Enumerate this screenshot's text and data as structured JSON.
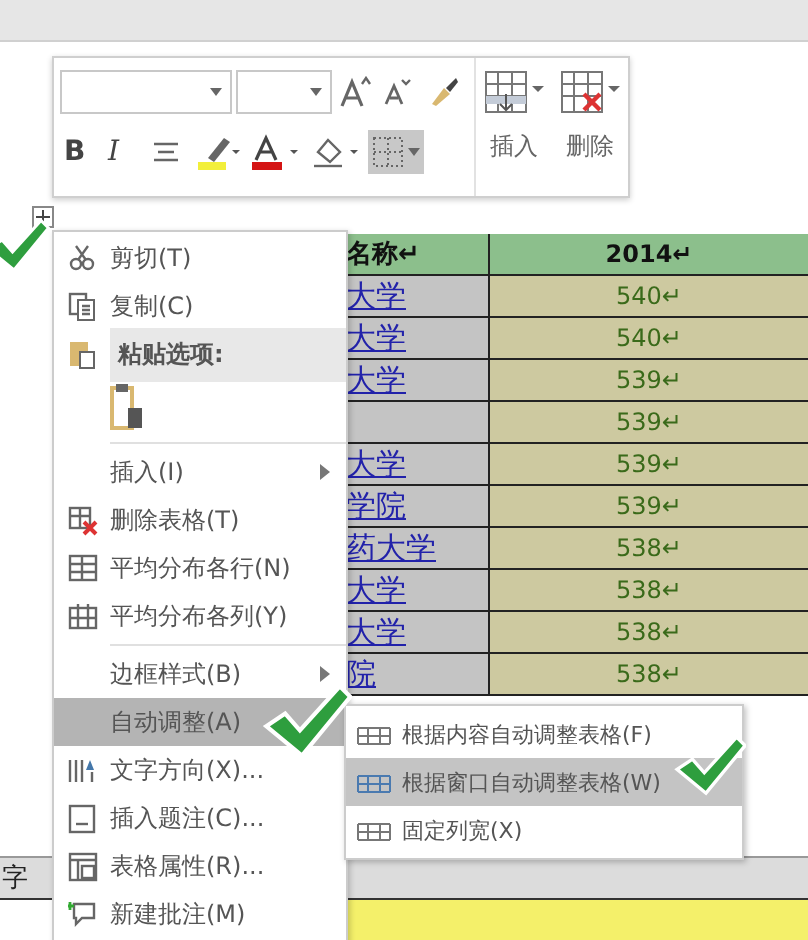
{
  "mini_toolbar": {
    "row_1": [
      {
        "kind": "combo"
      },
      {
        "kind": "combo-small"
      },
      {
        "kind": "grow-font"
      },
      {
        "kind": "shrink-font"
      },
      {
        "kind": "painter"
      }
    ],
    "row_2": [
      {
        "kind": "text-bold",
        "label": "B",
        "selected": false
      },
      {
        "kind": "text-italic",
        "label": "I",
        "selected": false
      },
      {
        "kind": "align",
        "selected": false
      },
      {
        "kind": "highlight",
        "selected": false
      },
      {
        "kind": "font-color",
        "selected": false
      },
      {
        "kind": "shading",
        "selected": false
      },
      {
        "kind": "borders",
        "selected": true
      }
    ],
    "insert_label": "插入",
    "delete_label": "删除"
  },
  "table": {
    "header": [
      "名称↵",
      "2014↵"
    ],
    "rows": [
      [
        "大学",
        "540↵"
      ],
      [
        "大学",
        "540↵"
      ],
      [
        "大学",
        "539↵"
      ],
      [
        "",
        "539↵"
      ],
      [
        "大学",
        "539↵"
      ],
      [
        "学院",
        "539↵"
      ],
      [
        "药大学",
        "538↵"
      ],
      [
        "大学",
        "538↵"
      ],
      [
        "大学",
        "538↵"
      ],
      [
        "院",
        "538↵"
      ]
    ]
  },
  "side_text": "字",
  "context_menu": [
    {
      "kind": "item",
      "label": "剪切(T)",
      "submenu": false,
      "selected": false
    },
    {
      "kind": "item",
      "label": "复制(C)",
      "submenu": false,
      "selected": false
    },
    {
      "kind": "header",
      "label": "粘贴选项:",
      "submenu": false,
      "selected": false
    },
    {
      "kind": "paste",
      "submenu": false,
      "selected": false
    },
    {
      "kind": "item",
      "label": "插入(I)",
      "submenu": true,
      "selected": false
    },
    {
      "kind": "item",
      "label": "删除表格(T)",
      "submenu": false,
      "selected": false
    },
    {
      "kind": "item",
      "label": "平均分布各行(N)",
      "submenu": false,
      "selected": false
    },
    {
      "kind": "item",
      "label": "平均分布各列(Y)",
      "submenu": false,
      "selected": false
    },
    {
      "kind": "item",
      "label": "边框样式(B)",
      "submenu": true,
      "selected": false
    },
    {
      "kind": "item",
      "label": "自动调整(A)",
      "submenu": false,
      "selected": true
    },
    {
      "kind": "item",
      "label": "文字方向(X)...",
      "submenu": false,
      "selected": false
    },
    {
      "kind": "item",
      "label": "插入题注(C)...",
      "submenu": false,
      "selected": false
    },
    {
      "kind": "item",
      "label": "表格属性(R)...",
      "submenu": false,
      "selected": false
    },
    {
      "kind": "item",
      "label": "新建批注(M)",
      "submenu": false,
      "selected": false
    }
  ],
  "submenu": [
    {
      "label": "根据内容自动调整表格(F)",
      "selected": false
    },
    {
      "label": "根据窗口自动调整表格(W)",
      "selected": true
    },
    {
      "label": "固定列宽(X)",
      "selected": false
    }
  ]
}
